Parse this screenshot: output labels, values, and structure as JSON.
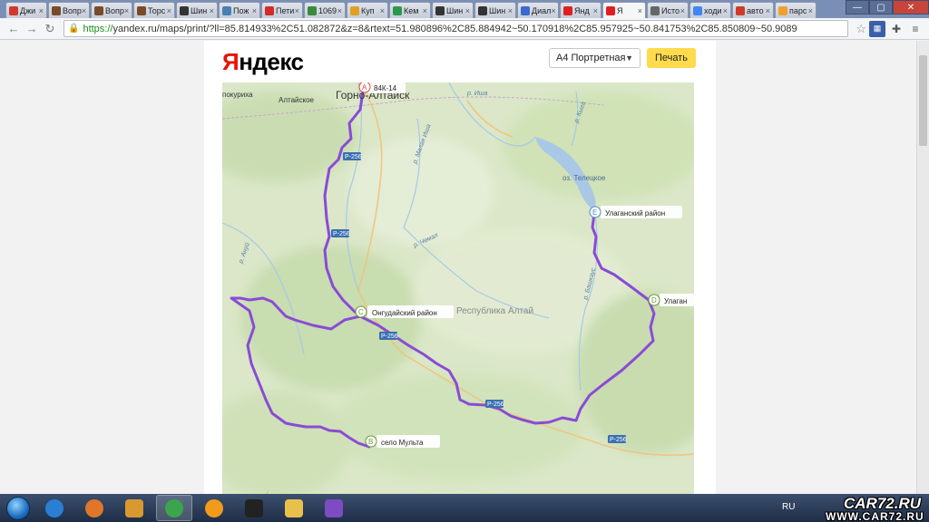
{
  "tabs": [
    {
      "label": "Джи",
      "icon": "car72-icon",
      "color": "#d03a2a"
    },
    {
      "label": "Вопр",
      "icon": "forum-icon",
      "color": "#7a4b2a"
    },
    {
      "label": "Вопр",
      "icon": "forum-icon",
      "color": "#7a4b2a"
    },
    {
      "label": "Торс",
      "icon": "forum-icon",
      "color": "#7a4b2a"
    },
    {
      "label": "Шин",
      "icon": "tire-icon",
      "color": "#333333"
    },
    {
      "label": "Пож",
      "icon": "page-icon",
      "color": "#4a7fb5"
    },
    {
      "label": "Пети",
      "icon": "petition-icon",
      "color": "#d12b2b"
    },
    {
      "label": "1069",
      "icon": "globe-icon",
      "color": "#3a8a3a"
    },
    {
      "label": "Куп",
      "icon": "shop-icon",
      "color": "#e0a020"
    },
    {
      "label": "Кем",
      "icon": "sheet-icon",
      "color": "#2a9a4a"
    },
    {
      "label": "Шин",
      "icon": "tire-icon",
      "color": "#333333"
    },
    {
      "label": "Шин",
      "icon": "tire-icon",
      "color": "#333333"
    },
    {
      "label": "Диал",
      "icon": "video-icon",
      "color": "#3a6ad0"
    },
    {
      "label": "Янд",
      "icon": "map-pin-icon",
      "color": "#e02020"
    },
    {
      "label": "Я",
      "icon": "map-pin-icon",
      "color": "#e02020",
      "active": true
    },
    {
      "label": "Исто",
      "icon": "history-icon",
      "color": "#666666"
    },
    {
      "label": "ходи",
      "icon": "google-icon",
      "color": "#4285f4"
    },
    {
      "label": "авто",
      "icon": "car72-icon",
      "color": "#d03a2a"
    },
    {
      "label": "парс",
      "icon": "sun-icon",
      "color": "#f0a030"
    }
  ],
  "toolbar": {
    "url_scheme": "https://",
    "url_rest": "yandex.ru/maps/print/?ll=85.814933%2C51.082872&z=8&rtext=51.980896%2C85.884942~50.170918%2C85.957925~50.841753%2C85.850809~50.9089"
  },
  "header": {
    "logo_first": "Я",
    "logo_rest": "ндекс",
    "paper_format": "А4 Портретная",
    "print_label": "Печать"
  },
  "map": {
    "route_color": "#8a4bd6",
    "waypoints": [
      {
        "letter": "A",
        "label": "84К-14"
      },
      {
        "letter": "B",
        "label": "село Мульта"
      },
      {
        "letter": "C",
        "label": "Онгудайский район"
      },
      {
        "letter": "D",
        "label": "Улаган"
      },
      {
        "letter": "E",
        "label": "Улаганский район"
      }
    ],
    "places": {
      "gorno": "Горно-Алтайск",
      "altaiskoe": "Алтайское",
      "pokrikha": "покуриха",
      "teletskoe": "оз. Телецкое",
      "respublika": "Республика Алтай"
    },
    "rivers": {
      "isha": "р. Иша",
      "malaya": "р. Малая Иша",
      "kyga": "р. Кыга",
      "chemal": "р. Чемал",
      "anuy": "р. Ануй",
      "bashkaus": "р. Башкаус"
    },
    "road_p256": "Р-256"
  },
  "taskbar": {
    "language": "RU",
    "apps": [
      {
        "name": "ie-icon",
        "color": "#2a7fd4"
      },
      {
        "name": "firefox-icon",
        "color": "#e0762a"
      },
      {
        "name": "media-player-icon",
        "color": "#d89a30"
      },
      {
        "name": "chrome-icon",
        "color": "#3aa54a",
        "active": true
      },
      {
        "name": "orange-app-icon",
        "color": "#f29a1a"
      },
      {
        "name": "camera-icon",
        "color": "#222222"
      },
      {
        "name": "folder-icon",
        "color": "#e7c14a"
      },
      {
        "name": "visual-studio-icon",
        "color": "#7d4bc2"
      }
    ]
  },
  "watermark": {
    "line1": "CAR72.RU",
    "line2": "WWW.CAR72.RU"
  }
}
